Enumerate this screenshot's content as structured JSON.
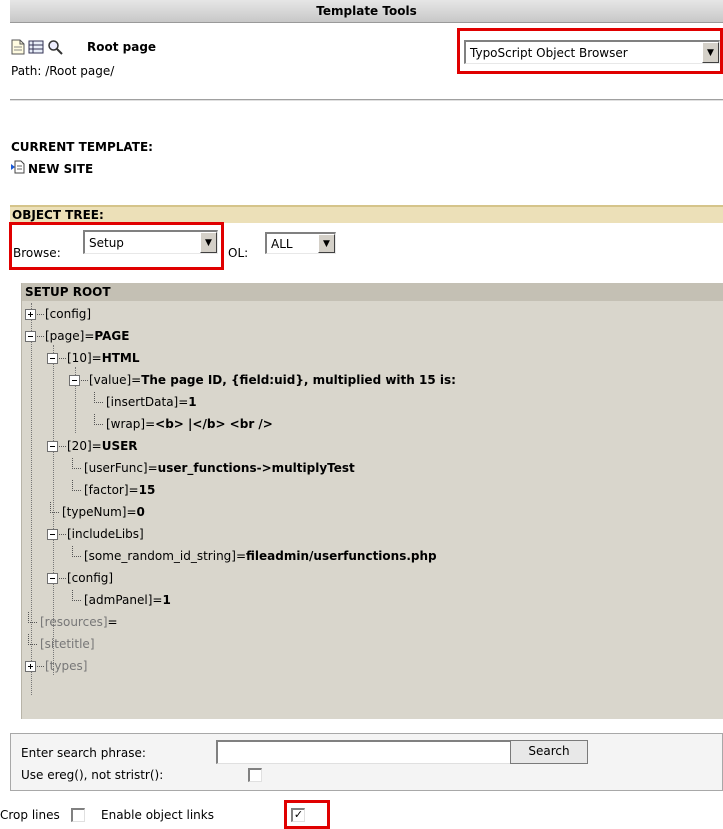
{
  "module_header": {
    "title": "Template Tools"
  },
  "page_info": {
    "title": "Root page",
    "path": "Path: /Root page/"
  },
  "function_menu": {
    "selected": "TypoScript Object Browser"
  },
  "current_template": {
    "label": "CURRENT TEMPLATE:",
    "name": "NEW SITE"
  },
  "object_tree": {
    "label": "OBJECT TREE:",
    "browse_label": "Browse:",
    "browse_value": "Setup",
    "ol_label": "OL:",
    "ol_value": "ALL"
  },
  "tree": {
    "root_label": "SETUP ROOT",
    "rows": [
      {
        "key": "[config]",
        "eq": "",
        "value": "",
        "state": "collapsed"
      },
      {
        "key": "[page]",
        "eq": "=",
        "value": "PAGE",
        "state": "expanded"
      },
      {
        "key": "[10]",
        "eq": "=",
        "value": "HTML",
        "state": "expanded"
      },
      {
        "key": "[value]",
        "eq": "=",
        "value": "The page ID, {field:uid}, multiplied with 15 is:",
        "state": "expanded"
      },
      {
        "key": "[insertData]",
        "eq": "=",
        "value": "1",
        "state": "leaf"
      },
      {
        "key": "[wrap]",
        "eq": "=",
        "value": "<b> |</b> <br />",
        "state": "leaf"
      },
      {
        "key": "[20]",
        "eq": "=",
        "value": "USER",
        "state": "expanded"
      },
      {
        "key": "[userFunc]",
        "eq": "=",
        "value": "user_functions->multiplyTest",
        "state": "leaf"
      },
      {
        "key": "[factor]",
        "eq": "=",
        "value": "15",
        "state": "leaf"
      },
      {
        "key": "[typeNum]",
        "eq": "=",
        "value": "0",
        "state": "leaf"
      },
      {
        "key": "[includeLibs]",
        "eq": "",
        "value": "",
        "state": "expanded"
      },
      {
        "key": "[some_random_id_string]",
        "eq": "=",
        "value": "fileadmin/userfunctions.php",
        "state": "leaf"
      },
      {
        "key": "[config]",
        "eq": "",
        "value": "",
        "state": "expanded"
      },
      {
        "key": "[admPanel]",
        "eq": "=",
        "value": "1",
        "state": "leaf"
      },
      {
        "key": "[resources]",
        "eq": "=",
        "value": "",
        "state": "leaf"
      },
      {
        "key": "[sitetitle]",
        "eq": "",
        "value": "",
        "state": "leaf"
      },
      {
        "key": "[types]",
        "eq": "",
        "value": "",
        "state": "collapsed"
      }
    ]
  },
  "search": {
    "label": "Enter search phrase:",
    "value": "",
    "button": "Search",
    "ereg_label": "Use ereg(), not stristr():",
    "ereg_checked": false
  },
  "options": {
    "crop_label": "Crop lines",
    "crop_checked": false,
    "links_label": "Enable object links",
    "links_checked": true,
    "check_mark": "✓"
  },
  "icons": [
    "page-icon",
    "list-view-icon",
    "search-icon",
    "expand-icon",
    "collapse-icon",
    "template-icon"
  ],
  "colors": {
    "highlight": "#e00000",
    "object_tree_bar": "#ece0b8",
    "tree_bg": "#d9d6cc"
  }
}
